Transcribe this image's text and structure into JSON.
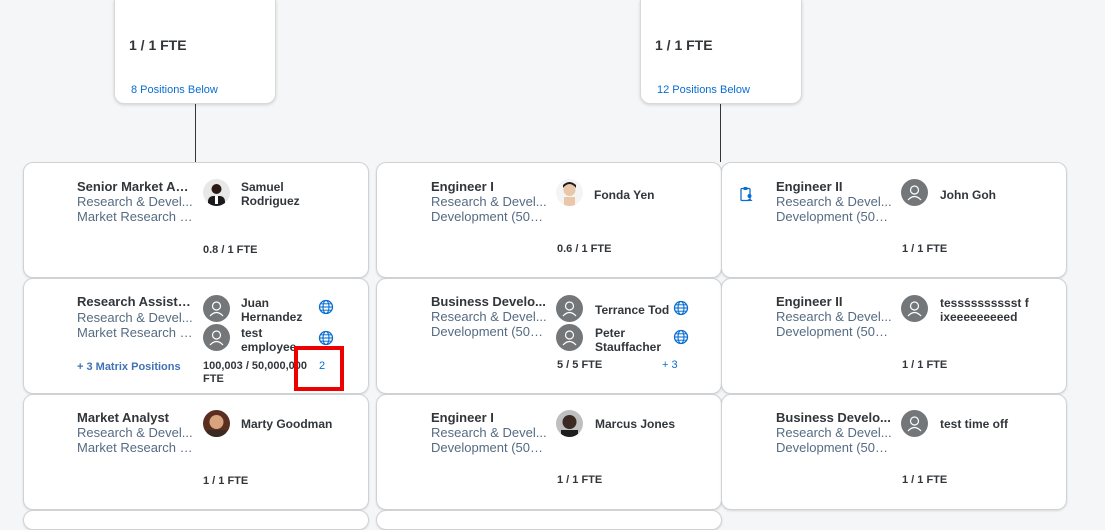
{
  "top_nodes": [
    {
      "fte": "1 / 1 FTE",
      "positions_link": "8 Positions Below"
    },
    {
      "fte": "1 / 1 FTE",
      "positions_link": "12 Positions Below"
    }
  ],
  "columns": [
    {
      "rows": [
        {
          "title": "Senior Market An...",
          "dept": "Research & Devel...",
          "sub": "Market Research (...",
          "people": [
            {
              "name": "Samuel Rodriguez",
              "avatar": "photo"
            }
          ],
          "fte": "0.8 / 1 FTE"
        },
        {
          "title": "Research Assistant",
          "dept": "Research & Devel...",
          "sub": "Market Research (...",
          "people": [
            {
              "name": "Juan Hernandez",
              "avatar": "placeholder"
            },
            {
              "name": "test employee",
              "avatar": "placeholder"
            }
          ],
          "fte": "100,003 / 50,000,000 FTE",
          "matrix_link": "+ 3 Matrix Positions",
          "more": "2"
        },
        {
          "title": "Market Analyst",
          "dept": "Research & Devel...",
          "sub": "Market Research (...",
          "people": [
            {
              "name": "Marty Goodman",
              "avatar": "photo"
            }
          ],
          "fte": "1 / 1 FTE"
        }
      ]
    },
    {
      "rows": [
        {
          "title": "Engineer I",
          "dept": "Research & Devel...",
          "sub": "Development (500...",
          "people": [
            {
              "name": "Fonda Yen",
              "avatar": "photo"
            }
          ],
          "fte": "0.6 / 1 FTE"
        },
        {
          "title": "Business Develo...",
          "dept": "Research & Devel...",
          "sub": "Development (500...",
          "people": [
            {
              "name": "Terrance Tod",
              "avatar": "placeholder"
            },
            {
              "name": "Peter Stauffacher",
              "avatar": "placeholder"
            }
          ],
          "fte": "5 / 5 FTE",
          "more": "+ 3"
        },
        {
          "title": "Engineer I",
          "dept": "Research & Devel...",
          "sub": "Development (500...",
          "people": [
            {
              "name": "Marcus Jones",
              "avatar": "photo"
            }
          ],
          "fte": "1 / 1 FTE"
        }
      ]
    },
    {
      "rows": [
        {
          "title": "Engineer II",
          "dept": "Research & Devel...",
          "sub": "Development (500...",
          "people": [
            {
              "name": "John Goh",
              "avatar": "placeholder"
            }
          ],
          "fte": "1 / 1 FTE"
        },
        {
          "title": "Engineer II",
          "dept": "Research & Devel...",
          "sub": "Development (500...",
          "people": [
            {
              "name": "tesssssssssst fixeeeeeeeeed",
              "avatar": "placeholder"
            }
          ],
          "fte": "1 / 1 FTE"
        },
        {
          "title": "Business Develo...",
          "dept": "Research & Devel...",
          "sub": "Development (500...",
          "people": [
            {
              "name": "test time off",
              "avatar": "placeholder"
            }
          ],
          "fte": "1 / 1 FTE"
        }
      ]
    }
  ],
  "colors": {
    "link": "#0a6ed1",
    "highlight": "#e00000",
    "subtext": "#556b82"
  }
}
